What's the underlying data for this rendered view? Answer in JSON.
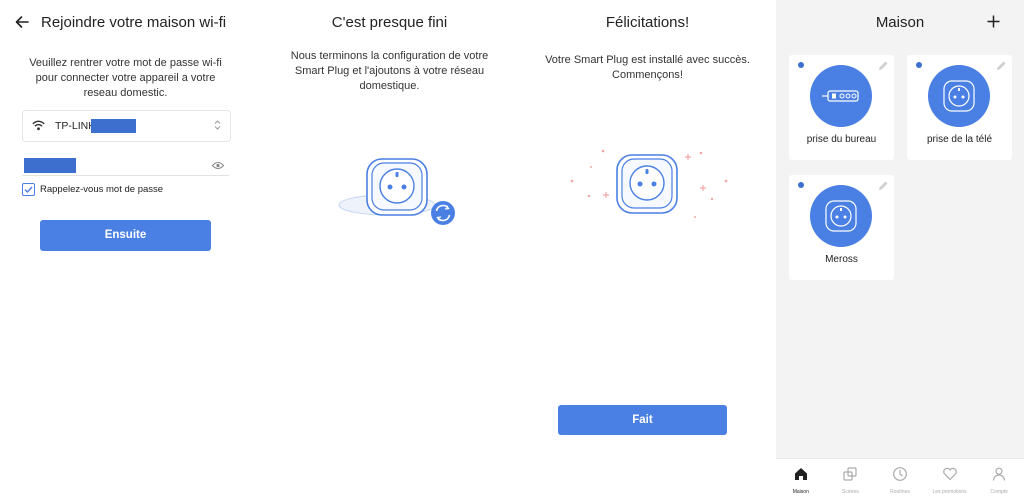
{
  "wifi": {
    "title": "Rejoindre votre maison wi-fi",
    "instructions": "Veuillez rentrer votre mot de passe wi-fi pour connecter votre appareil a votre reseau domestic.",
    "network_name": "TP-LINK",
    "remember_label": "Rappelez-vous mot de passe",
    "next_button": "Ensuite"
  },
  "setup": {
    "title": "C'est presque fini",
    "message": "Nous terminons la configuration de votre Smart Plug et l'ajoutons à votre réseau domestique."
  },
  "done": {
    "title": "Félicitations!",
    "message": "Votre Smart Plug est installé avec succès. Commençons!",
    "done_button": "Fait"
  },
  "home": {
    "title": "Maison",
    "add_icon": "plus-icon",
    "devices": [
      {
        "name": "prise du bureau",
        "icon": "power-strip-icon"
      },
      {
        "name": "prise de la télé",
        "icon": "smart-plug-icon"
      },
      {
        "name": "Meross",
        "icon": "smart-plug-icon"
      }
    ],
    "tabs": [
      {
        "label": "Maison",
        "icon": "home-icon",
        "active": true
      },
      {
        "label": "Scènes",
        "icon": "scenes-icon",
        "active": false
      },
      {
        "label": "Routines",
        "icon": "clock-icon",
        "active": false
      },
      {
        "label": "Les promotions",
        "icon": "heart-icon",
        "active": false
      },
      {
        "label": "Compte",
        "icon": "person-icon",
        "active": false
      }
    ]
  },
  "colors": {
    "accent": "#4a7fe3",
    "redaction": "#3d6fcf",
    "background_home": "#f3f3f3"
  }
}
